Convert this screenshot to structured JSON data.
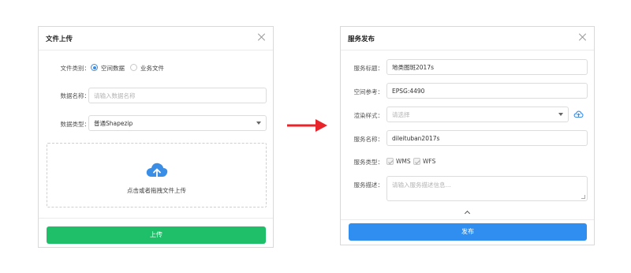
{
  "upload_dialog": {
    "title": "文件上传",
    "file_type_label": "文件类别：",
    "file_type_options": [
      "空间数据",
      "业务文件"
    ],
    "data_name_label": "数据名称：",
    "data_name_placeholder": "请输入数据名称",
    "data_type_label": "数据类型：",
    "data_type_value": "普通Shapezip",
    "dropzone_text": "点击或者拖拽文件上传",
    "upload_button": "上传"
  },
  "publish_dialog": {
    "title": "服务发布",
    "service_title_label": "服务标题：",
    "service_title_value": "地类图斑2017s",
    "spatial_ref_label": "空间参考：",
    "spatial_ref_value": "EPSG:4490",
    "render_style_label": "渲染样式：",
    "render_style_placeholder": "请选择",
    "service_name_label": "服务名称：",
    "service_name_value": "dileituban2017s",
    "service_type_label": "服务类型：",
    "service_types": [
      "WMS",
      "WFS"
    ],
    "service_desc_label": "服务描述：",
    "service_desc_placeholder": "请输入服务描述信息...",
    "publish_button": "发布"
  },
  "colors": {
    "arrow": "#e8242a",
    "upload_green": "#1fbf69",
    "publish_blue": "#2f8ef0",
    "icon_blue": "#3a8ee6"
  }
}
